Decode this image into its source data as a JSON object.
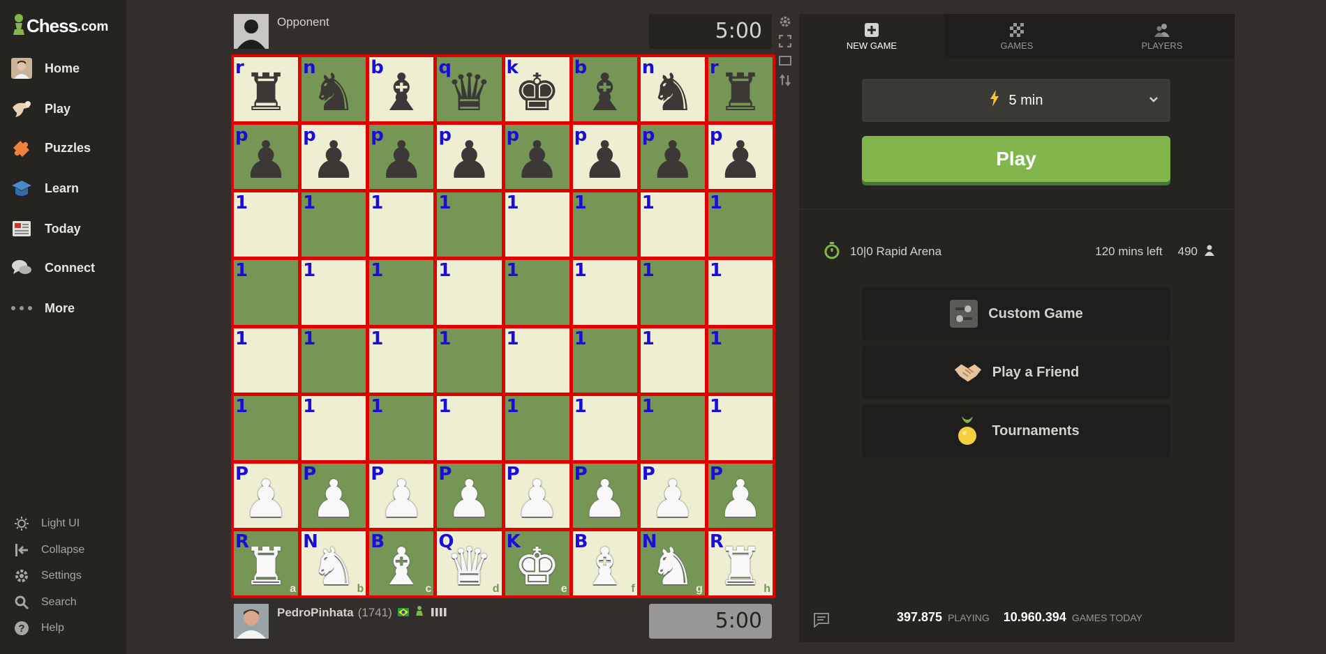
{
  "sidebar": {
    "logo_word": "Chess",
    "logo_suffix": ".com",
    "items": [
      {
        "label": "Home",
        "icon": "home-avatar-icon"
      },
      {
        "label": "Play",
        "icon": "play-hand-icon"
      },
      {
        "label": "Puzzles",
        "icon": "puzzle-icon"
      },
      {
        "label": "Learn",
        "icon": "learn-cap-icon"
      },
      {
        "label": "Today",
        "icon": "newspaper-icon"
      },
      {
        "label": "Connect",
        "icon": "chat-bubbles-icon"
      },
      {
        "label": "More",
        "icon": "dots-icon"
      }
    ],
    "footer": [
      {
        "label": "Light UI",
        "icon": "sun-icon"
      },
      {
        "label": "Collapse",
        "icon": "collapse-icon"
      },
      {
        "label": "Settings",
        "icon": "gear-icon"
      },
      {
        "label": "Search",
        "icon": "search-icon"
      },
      {
        "label": "Help",
        "icon": "help-icon"
      }
    ]
  },
  "opponent": {
    "name": "Opponent",
    "clock": "5:00"
  },
  "player": {
    "name": "PedroPinhata",
    "rating": "(1741)",
    "clock": "5:00"
  },
  "board": {
    "files": [
      "a",
      "b",
      "c",
      "d",
      "e",
      "f",
      "g",
      "h"
    ],
    "tags": [
      [
        "r",
        "n",
        "b",
        "q",
        "k",
        "b",
        "n",
        "r"
      ],
      [
        "p",
        "p",
        "p",
        "p",
        "p",
        "p",
        "p",
        "p"
      ],
      [
        "1",
        "1",
        "1",
        "1",
        "1",
        "1",
        "1",
        "1"
      ],
      [
        "1",
        "1",
        "1",
        "1",
        "1",
        "1",
        "1",
        "1"
      ],
      [
        "1",
        "1",
        "1",
        "1",
        "1",
        "1",
        "1",
        "1"
      ],
      [
        "1",
        "1",
        "1",
        "1",
        "1",
        "1",
        "1",
        "1"
      ],
      [
        "P",
        "P",
        "P",
        "P",
        "P",
        "P",
        "P",
        "P"
      ],
      [
        "R",
        "N",
        "B",
        "Q",
        "K",
        "B",
        "N",
        "R"
      ]
    ]
  },
  "tabs": [
    {
      "label": "NEW GAME",
      "icon": "plus-icon",
      "active": true
    },
    {
      "label": "GAMES",
      "icon": "checker-icon",
      "active": false
    },
    {
      "label": "PLAYERS",
      "icon": "players-icon",
      "active": false
    }
  ],
  "time_control": {
    "label": "5 min"
  },
  "play_button": "Play",
  "arena": {
    "name": "10|0 Rapid Arena",
    "time_left": "120 mins left",
    "players": "490"
  },
  "options": [
    {
      "label": "Custom Game",
      "icon": "sliders-icon"
    },
    {
      "label": "Play a Friend",
      "icon": "handshake-icon"
    },
    {
      "label": "Tournaments",
      "icon": "trophy-medal-icon"
    }
  ],
  "stats": {
    "playing_count": "397.875",
    "playing_label": "PLAYING",
    "games_count": "10.960.394",
    "games_label": "GAMES TODAY"
  },
  "colors": {
    "light_square": "#eeeed2",
    "dark_square": "#769656",
    "accent": "#81b64c",
    "grid_lines": "#e00000",
    "tag_color": "#1a0dd6"
  }
}
